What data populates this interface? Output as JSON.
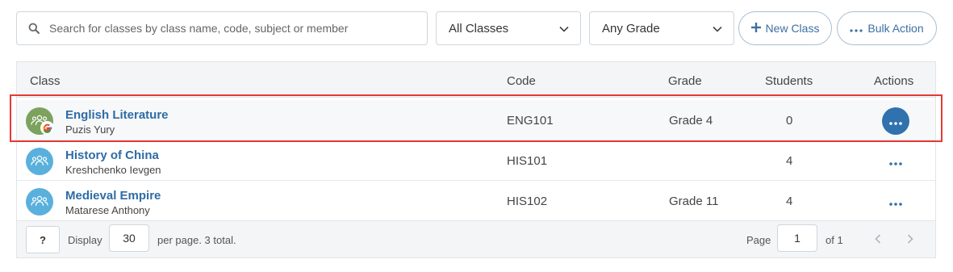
{
  "toolbar": {
    "search_placeholder": "Search for classes by class name, code, subject or member",
    "class_filter": "All Classes",
    "grade_filter": "Any Grade",
    "new_class_label": "New Class",
    "bulk_action_label": "Bulk Action"
  },
  "table": {
    "columns": {
      "class": "Class",
      "code": "Code",
      "grade": "Grade",
      "students": "Students",
      "actions": "Actions"
    },
    "rows": [
      {
        "name": "English Literature",
        "member": "Puzis Yury",
        "code": "ENG101",
        "grade": "Grade 4",
        "students": "0",
        "avatar_color": "#7da25e",
        "google_synced": true,
        "selected": true
      },
      {
        "name": "History of China",
        "member": "Kreshchenko Ievgen",
        "code": "HIS101",
        "grade": "",
        "students": "4",
        "avatar_color": "#5ab0dc",
        "google_synced": false,
        "selected": false
      },
      {
        "name": "Medieval Empire",
        "member": "Matarese Anthony",
        "code": "HIS102",
        "grade": "Grade 11",
        "students": "4",
        "avatar_color": "#5ab0dc",
        "google_synced": false,
        "selected": false
      }
    ]
  },
  "footer": {
    "help_label": "?",
    "display_label": "Display",
    "per_page_value": "30",
    "per_page_suffix": "per page. 3 total.",
    "page_label": "Page",
    "page_value": "1",
    "of_label": "of 1"
  },
  "colors": {
    "link": "#2e6ca5",
    "primary": "#2f72ae",
    "highlight": "#e53935"
  }
}
